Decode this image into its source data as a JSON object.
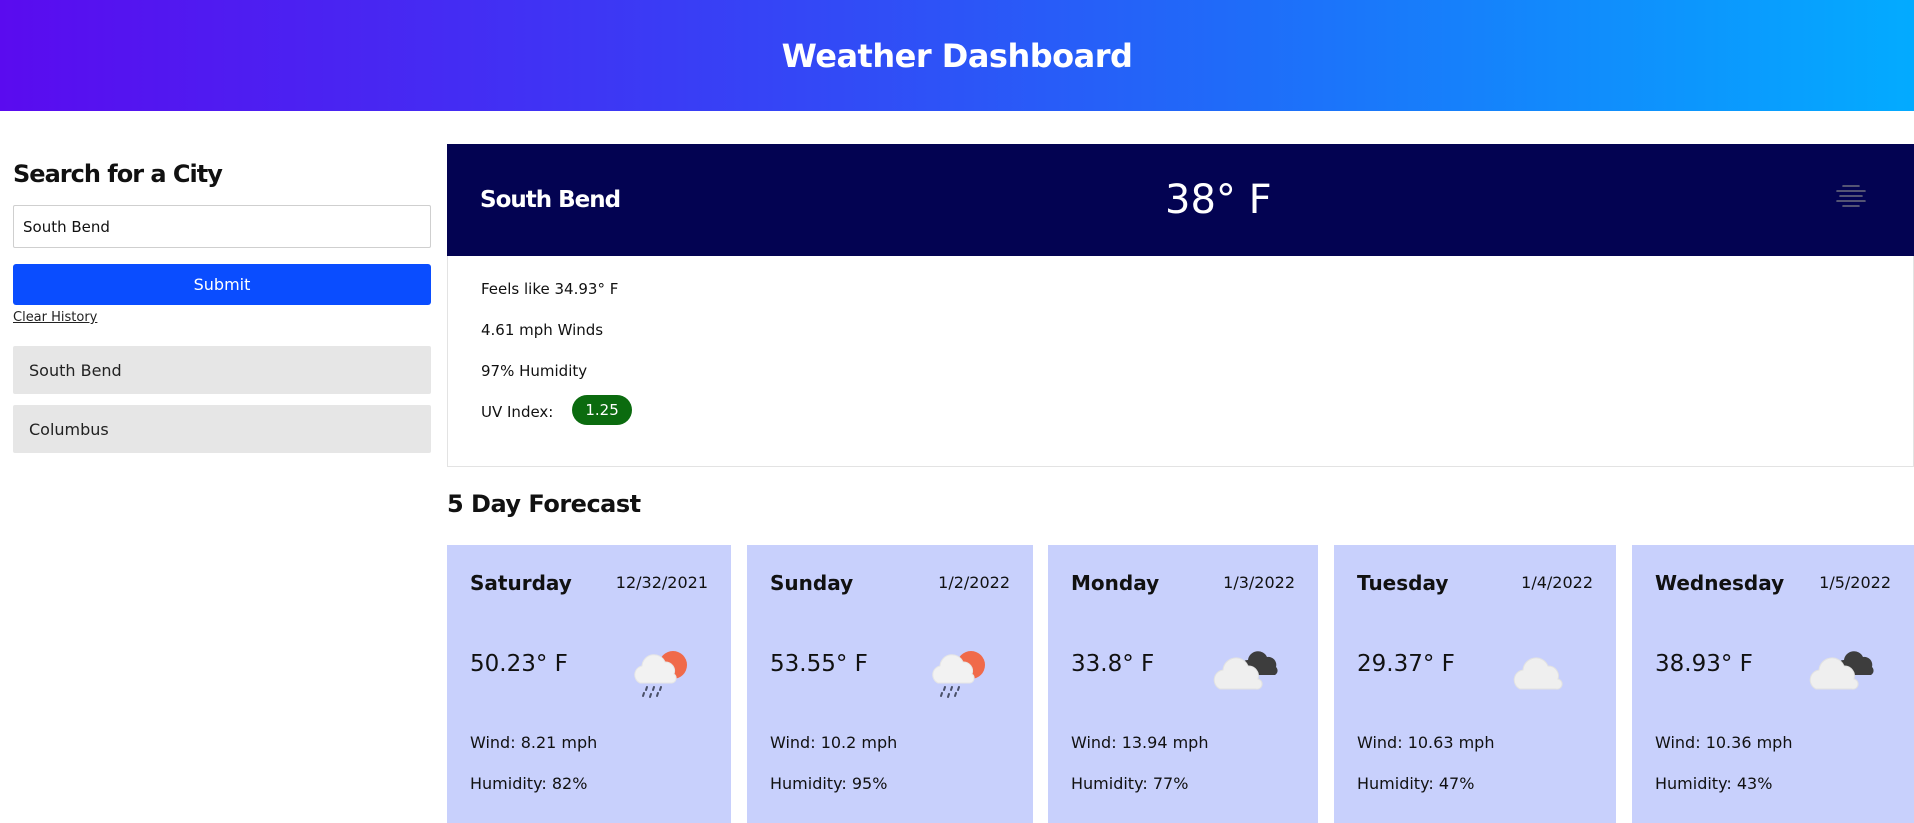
{
  "header": {
    "title": "Weather Dashboard"
  },
  "sidebar": {
    "search_heading": "Search for a City",
    "search_value": "South Bend",
    "submit_label": "Submit",
    "clear_label": "Clear History",
    "history": [
      "South Bend",
      "Columbus"
    ]
  },
  "current": {
    "city": "South Bend",
    "temp": "38° F",
    "icon": "fog-icon",
    "feels_like": "Feels like 34.93° F",
    "winds": "4.61 mph Winds",
    "humidity": "97% Humidity",
    "uv_label": "UV Index:",
    "uv_value": "1.25",
    "uv_color": "#0b6b0f"
  },
  "forecast": {
    "title": "5 Day Forecast",
    "days": [
      {
        "day": "Saturday",
        "date": "12/32/2021",
        "temp": "50.23° F",
        "icon": "rain-sun-icon",
        "wind": "Wind: 8.21 mph",
        "humidity": "Humidity: 82%"
      },
      {
        "day": "Sunday",
        "date": "1/2/2022",
        "temp": "53.55° F",
        "icon": "rain-sun-icon",
        "wind": "Wind: 10.2 mph",
        "humidity": "Humidity: 95%"
      },
      {
        "day": "Monday",
        "date": "1/3/2022",
        "temp": "33.8° F",
        "icon": "broken-clouds-icon",
        "wind": "Wind: 13.94 mph",
        "humidity": "Humidity: 77%"
      },
      {
        "day": "Tuesday",
        "date": "1/4/2022",
        "temp": "29.37° F",
        "icon": "cloud-icon",
        "wind": "Wind: 10.63 mph",
        "humidity": "Humidity: 47%"
      },
      {
        "day": "Wednesday",
        "date": "1/5/2022",
        "temp": "38.93° F",
        "icon": "broken-clouds-icon",
        "wind": "Wind: 10.36 mph",
        "humidity": "Humidity: 43%"
      }
    ]
  },
  "colors": {
    "header_gradient": [
      "#5a0bef",
      "#03abff"
    ],
    "current_banner": "#030352",
    "submit": "#0a4dff",
    "card_bg": "#c8d0fc",
    "history_bg": "#e6e6e6"
  }
}
